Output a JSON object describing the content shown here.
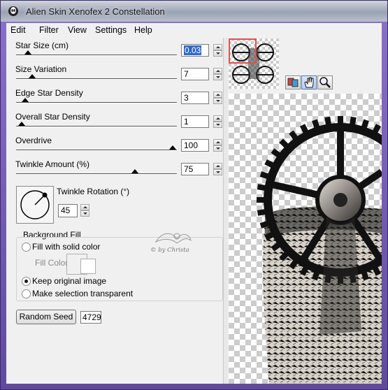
{
  "window": {
    "title": "Alien Skin Xenofex 2 Constellation"
  },
  "menu": [
    "Edit",
    "Filter",
    "View",
    "Settings",
    "Help"
  ],
  "sliders": [
    {
      "label": "Star Size (cm)",
      "value": "0.03",
      "level": 0.05,
      "selected": true
    },
    {
      "label": "Size Variation",
      "value": "7",
      "level": 0.08
    },
    {
      "label": "Edge Star Density",
      "value": "3",
      "level": 0.03
    },
    {
      "label": "Overall Star Density",
      "value": "1",
      "level": 0.01
    },
    {
      "label": "Overdrive",
      "value": "100",
      "level": 1.0
    },
    {
      "label": "Twinkle Amount (%)",
      "value": "75",
      "level": 0.75
    }
  ],
  "twinkle_rotation": {
    "label": "Twinkle Rotation (°)",
    "value": "45"
  },
  "background_fill": {
    "title": "Background Fill",
    "options": [
      {
        "label": "Fill with solid color",
        "checked": false
      },
      {
        "label": "Keep original image",
        "checked": true
      },
      {
        "label": "Make selection transparent",
        "checked": false
      }
    ],
    "fill_color_label": "Fill Color"
  },
  "watermark": {
    "text": "© by Christa"
  },
  "random_seed": {
    "label": "Random Seed",
    "value": "4729"
  },
  "tools": [
    "preview-toggle-icon",
    "hand-icon",
    "zoom-icon"
  ],
  "colors": {
    "titlebar": "#9aa2b2",
    "selection": "#3168c6",
    "nav_frame": "#e05050"
  }
}
